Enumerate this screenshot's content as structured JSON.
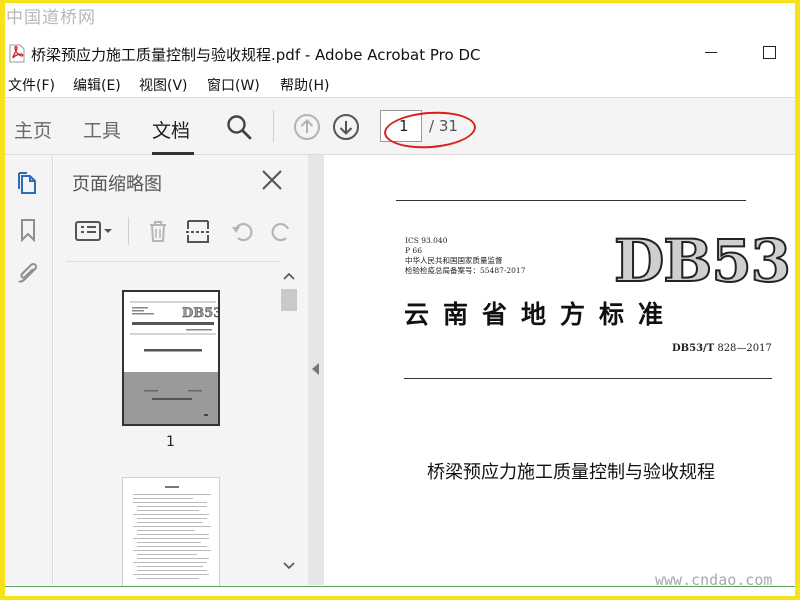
{
  "watermarks": {
    "top": "中国道桥网",
    "bottom": "www.cndao.com"
  },
  "window": {
    "title": "桥梁预应力施工质量控制与验收规程.pdf - Adobe Acrobat Pro DC",
    "icon": "pdf-file-icon"
  },
  "menu": {
    "items": [
      "文件(F)",
      "编辑(E)",
      "视图(V)",
      "窗口(W)",
      "帮助(H)"
    ]
  },
  "toolbar": {
    "tabs": [
      "主页",
      "工具",
      "文档"
    ],
    "active_tab": "文档",
    "page_current": "1",
    "page_total": "/ 31"
  },
  "thumbnails_panel": {
    "title": "页面缩略图",
    "thumb_page_number": "1"
  },
  "document": {
    "meta_lines": [
      "ICS 93.040",
      "P 66",
      "中华人民共和国国家质量监督",
      "检验检疫总局备案号：55487-2017"
    ],
    "code": "DB53",
    "standard_title": "云南省地方标准",
    "standard_no_prefix": "DB53/T",
    "standard_no": "828—2017",
    "heading": "桥梁预应力施工质量控制与验收规程"
  },
  "colors": {
    "frame_border": "#f6e31c",
    "annotation_red": "#d9201c",
    "pdf_red": "#d31f1f"
  }
}
